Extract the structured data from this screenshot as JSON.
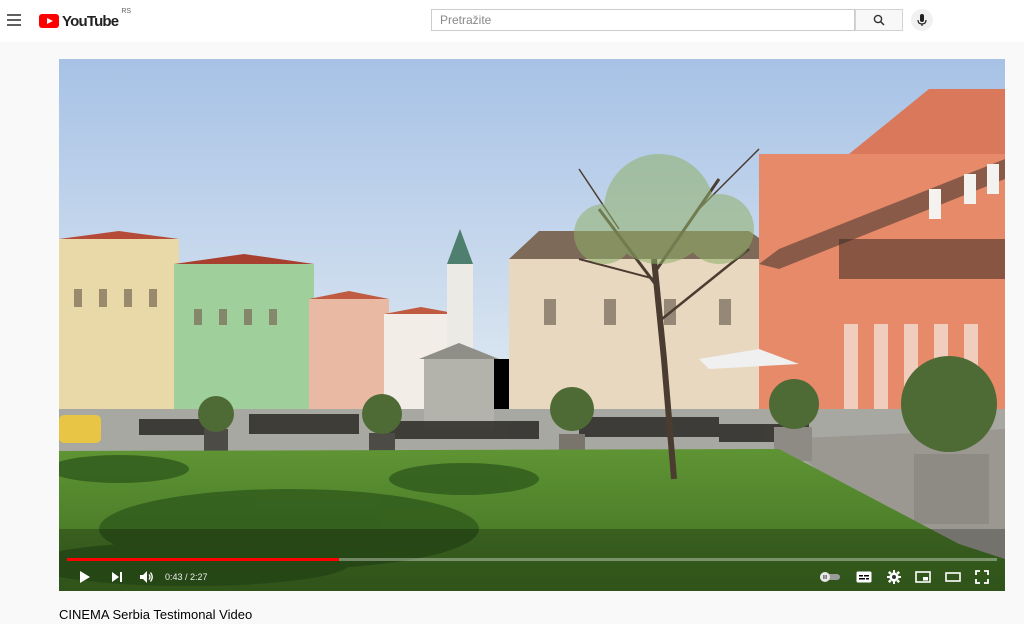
{
  "header": {
    "logo_text": "YouTube",
    "region": "RS",
    "search_placeholder": "Pretražite"
  },
  "player": {
    "current_time": "0:43",
    "duration": "2:27",
    "time_display": "0:43 / 2:27",
    "progress_fraction": 0.292,
    "progress_color": "#ff0000"
  },
  "video": {
    "title": "CINEMA Serbia Testimonal Video"
  },
  "colors": {
    "accent": "#ff0000",
    "topbar_bg": "#ffffff",
    "page_bg": "#f9f9f9"
  },
  "icons": [
    "menu-icon",
    "youtube-logo-icon",
    "search-icon",
    "microphone-icon",
    "play-icon",
    "next-icon",
    "volume-icon",
    "autoplay-toggle-icon",
    "subtitles-icon",
    "settings-icon",
    "miniplayer-icon",
    "theater-mode-icon",
    "fullscreen-icon"
  ]
}
